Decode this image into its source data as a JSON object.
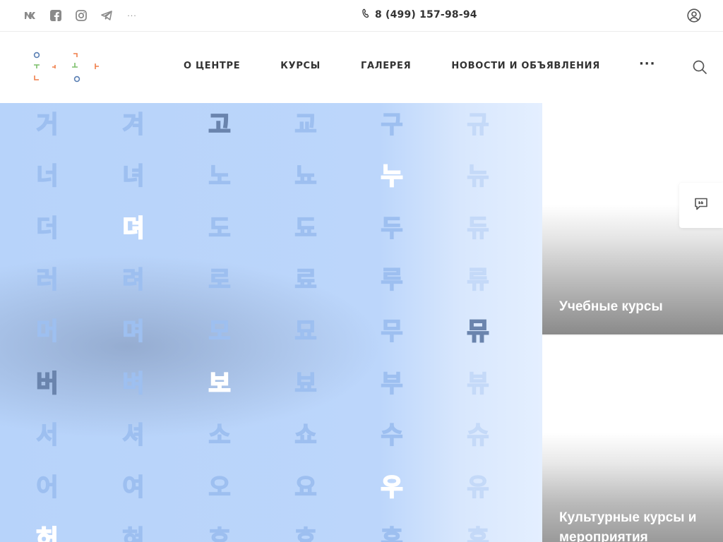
{
  "topbar": {
    "social": [
      {
        "name": "vk-icon"
      },
      {
        "name": "facebook-icon"
      },
      {
        "name": "instagram-icon"
      },
      {
        "name": "telegram-icon"
      },
      {
        "name": "more-social-icon",
        "label": "···"
      }
    ],
    "phone": "8 (499) 157-98-94"
  },
  "header": {
    "nav": [
      "О ЦЕНТРЕ",
      "КУРСЫ",
      "ГАЛЕРЕЯ",
      "НОВОСТИ И ОБЪЯВЛЕНИЯ"
    ],
    "more_label": "···"
  },
  "hero": {
    "rows": [
      [
        "거",
        "겨",
        "고",
        "교",
        "구",
        "규"
      ],
      [
        "너",
        "녀",
        "노",
        "뇨",
        "누",
        "뉴"
      ],
      [
        "더",
        "뎌",
        "도",
        "됴",
        "두",
        "듀"
      ],
      [
        "러",
        "려",
        "로",
        "료",
        "루",
        "류"
      ],
      [
        "머",
        "며",
        "모",
        "묘",
        "무",
        "뮤"
      ],
      [
        "버",
        "벼",
        "보",
        "뵤",
        "부",
        "뷰"
      ],
      [
        "서",
        "셔",
        "소",
        "쇼",
        "수",
        "슈"
      ],
      [
        "어",
        "여",
        "오",
        "요",
        "우",
        "유"
      ],
      [
        "허",
        "혀",
        "호",
        "효",
        "후",
        "휴"
      ]
    ]
  },
  "cards": [
    {
      "title": "Учебные курсы"
    },
    {
      "title": "Культурные курсы и мероприятия"
    }
  ],
  "colors": {
    "logo_orange": "#f07e4a",
    "logo_green": "#7bbf6a",
    "logo_blue": "#5a7fb3",
    "logo_red": "#e05a4a",
    "hero_blue": "#bcd6fb"
  }
}
